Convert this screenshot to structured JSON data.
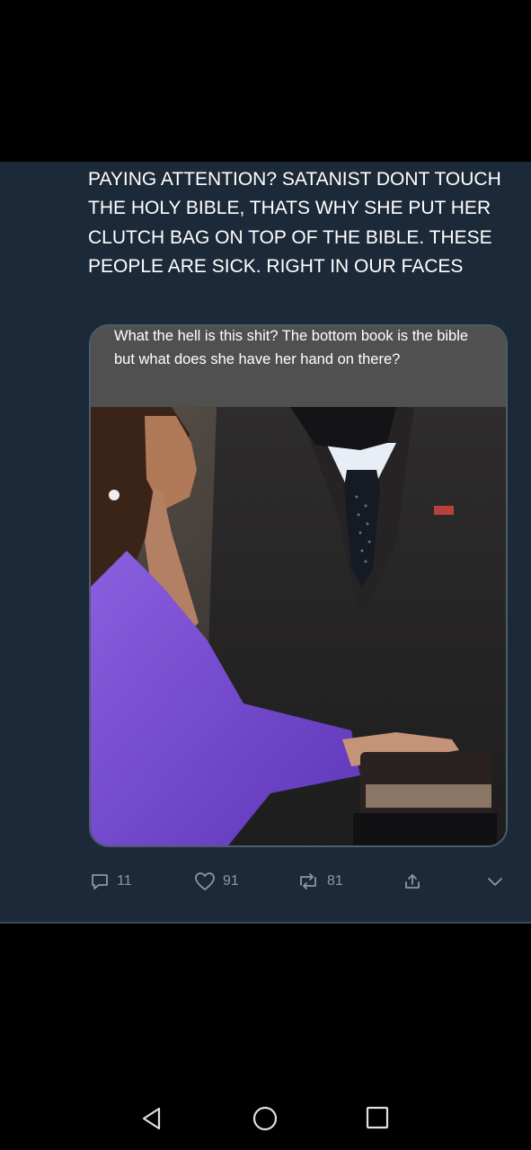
{
  "tweet": {
    "text": "PAYING ATTENTION? SATANIST DONT TOUCH THE HOLY BIBLE, THATS WHY SHE PUT HER CLUTCH BAG ON TOP OF THE BIBLE. THESE PEOPLE ARE SICK. RIGHT IN OUR FACES",
    "media_caption": "What the hell is this shit? The bottom book is the bible but what does she have her hand on there?",
    "actions": {
      "reply_count": "11",
      "like_count": "91",
      "retweet_count": "81"
    },
    "icons": {
      "reply": "reply-icon",
      "like": "heart-icon",
      "retweet": "retweet-icon",
      "share": "share-icon",
      "more": "chevron-down-icon"
    }
  },
  "nav": {
    "back": "back-triangle-icon",
    "home": "home-circle-icon",
    "recents": "recents-square-icon"
  },
  "colors": {
    "card_bg": "#1c2938",
    "action_gray": "#8899a6",
    "purple_suit": "#7a4fd4"
  }
}
